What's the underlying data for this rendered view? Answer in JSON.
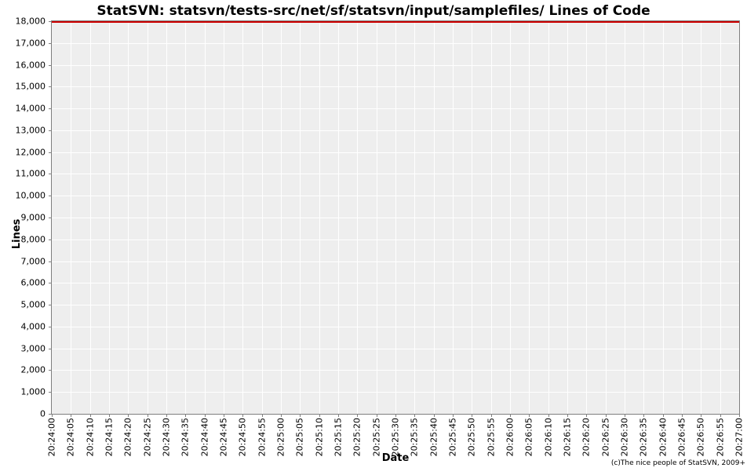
{
  "chart_data": {
    "type": "line",
    "title": "StatSVN: statsvn/tests-src/net/sf/statsvn/input/samplefiles/ Lines of Code",
    "xlabel": "Date",
    "ylabel": "Lines",
    "ylim": [
      0,
      18000
    ],
    "y_ticks": [
      0,
      1000,
      2000,
      3000,
      4000,
      5000,
      6000,
      7000,
      8000,
      9000,
      10000,
      11000,
      12000,
      13000,
      14000,
      15000,
      16000,
      17000,
      18000
    ],
    "y_tick_labels": [
      "0",
      "1,000",
      "2,000",
      "3,000",
      "4,000",
      "5,000",
      "6,000",
      "7,000",
      "8,000",
      "9,000",
      "10,000",
      "11,000",
      "12,000",
      "13,000",
      "14,000",
      "15,000",
      "16,000",
      "17,000",
      "18,000"
    ],
    "x_ticks": [
      "20:24:00",
      "20:24:05",
      "20:24:10",
      "20:24:15",
      "20:24:20",
      "20:24:25",
      "20:24:30",
      "20:24:35",
      "20:24:40",
      "20:24:45",
      "20:24:50",
      "20:24:55",
      "20:25:00",
      "20:25:05",
      "20:25:10",
      "20:25:15",
      "20:25:20",
      "20:25:25",
      "20:25:30",
      "20:25:35",
      "20:25:40",
      "20:25:45",
      "20:25:50",
      "20:25:55",
      "20:26:00",
      "20:26:05",
      "20:26:10",
      "20:26:15",
      "20:26:20",
      "20:26:25",
      "20:26:30",
      "20:26:35",
      "20:26:40",
      "20:26:45",
      "20:26:50",
      "20:26:55",
      "20:27:00"
    ],
    "series": [
      {
        "name": "Lines of Code",
        "color": "#cc0000",
        "x": [
          "20:24:00",
          "20:27:00"
        ],
        "values": [
          18000,
          18000
        ]
      }
    ]
  },
  "credit": "(c)The nice people of StatSVN, 2009+"
}
